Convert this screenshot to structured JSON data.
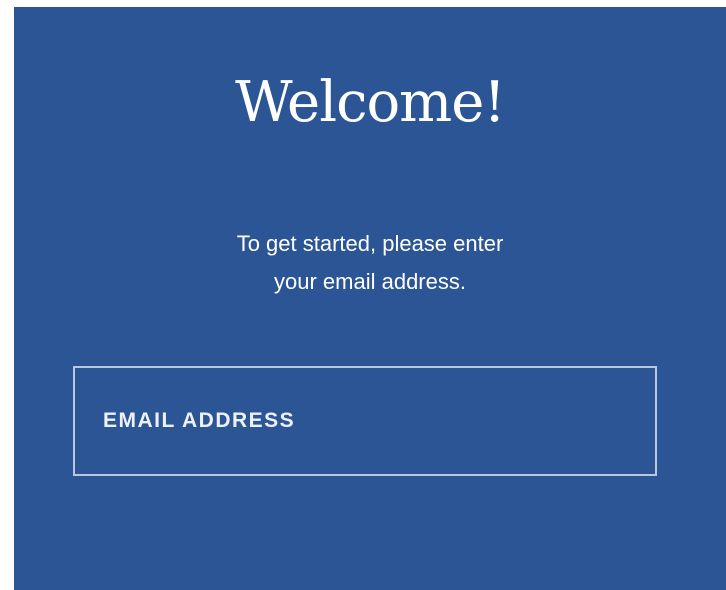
{
  "welcome": {
    "title": "Welcome!",
    "subtitle_line1": "To get started, please enter",
    "subtitle_line2": "your email address."
  },
  "email": {
    "placeholder": "EMAIL ADDRESS",
    "value": ""
  },
  "colors": {
    "background": "#2b5595",
    "text": "#ffffff",
    "input_border": "#b9c8e0"
  }
}
